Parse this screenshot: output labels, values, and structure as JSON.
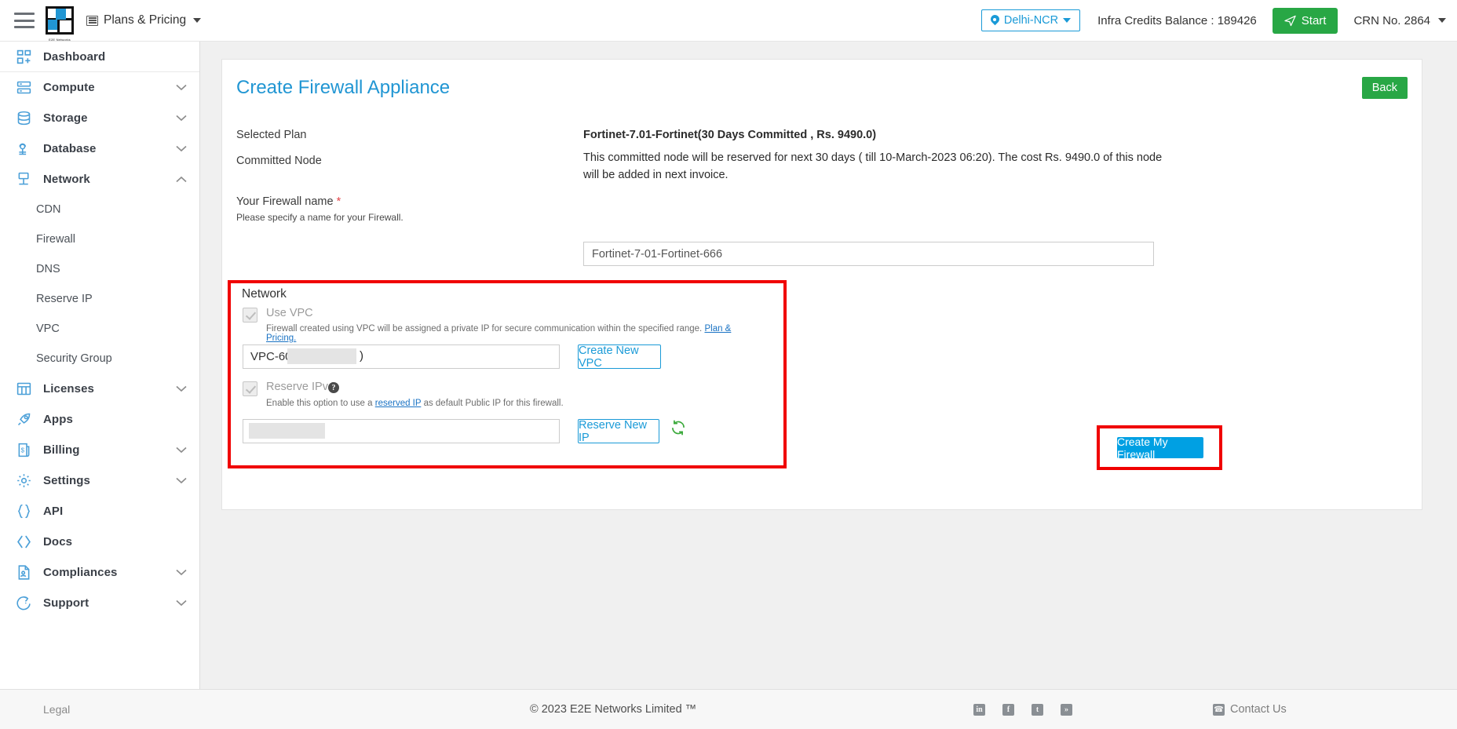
{
  "topbar": {
    "menu_icon": "hamburger-icon",
    "brand_name": "E2E Networks",
    "plans_pricing": "Plans & Pricing",
    "region": "Delhi-NCR",
    "credits": "Infra Credits Balance : 189426",
    "start_button": "Start",
    "crn": "CRN No. 2864"
  },
  "sidebar": {
    "items": [
      {
        "label": "Dashboard",
        "icon": "dashboard-icon",
        "expandable": false
      },
      {
        "label": "Compute",
        "icon": "compute-icon",
        "expandable": true,
        "state": "collapsed"
      },
      {
        "label": "Storage",
        "icon": "storage-icon",
        "expandable": true,
        "state": "collapsed"
      },
      {
        "label": "Database",
        "icon": "database-icon",
        "expandable": true,
        "state": "collapsed"
      },
      {
        "label": "Network",
        "icon": "network-icon",
        "expandable": true,
        "state": "expanded"
      },
      {
        "label": "Licenses",
        "icon": "licenses-icon",
        "expandable": true,
        "state": "collapsed"
      },
      {
        "label": "Apps",
        "icon": "apps-rocket-icon",
        "expandable": false
      },
      {
        "label": "Billing",
        "icon": "billing-icon",
        "expandable": true,
        "state": "collapsed"
      },
      {
        "label": "Settings",
        "icon": "gear-icon",
        "expandable": true,
        "state": "collapsed"
      },
      {
        "label": "API",
        "icon": "api-braces-icon",
        "expandable": false
      },
      {
        "label": "Docs",
        "icon": "docs-angle-brackets-icon",
        "expandable": false
      },
      {
        "label": "Compliances",
        "icon": "compliances-doc-icon",
        "expandable": true,
        "state": "collapsed"
      },
      {
        "label": "Support",
        "icon": "support-icon",
        "expandable": true,
        "state": "collapsed"
      }
    ],
    "network_children": [
      "CDN",
      "Firewall",
      "DNS",
      "Reserve IP",
      "VPC",
      "Security Group"
    ]
  },
  "page": {
    "title": "Create Firewall Appliance",
    "back_button": "Back",
    "selected_plan_label": "Selected Plan",
    "selected_plan_value": "Fortinet-7.01-Fortinet(30 Days Committed , Rs. 9490.0)",
    "committed_node_label": "Committed Node",
    "committed_node_value": "This committed node will be reserved for next 30 days ( till 10-March-2023 06:20). The cost Rs. 9490.0 of this node will be added in next invoice.",
    "firewall_name_label": "Your Firewall name",
    "firewall_name_required": "*",
    "firewall_name_hint": "Please specify a name for your Firewall.",
    "firewall_name_value": "Fortinet-7-01-Fortinet-666",
    "submit_button": "Create My Firewall"
  },
  "network": {
    "section_title": "Network",
    "use_vpc_label": "Use VPC",
    "use_vpc_checked": true,
    "use_vpc_desc_part1": "Firewall created using VPC will be assigned a private IP for secure communication within the specified range.",
    "use_vpc_desc_link": "Plan & Pricing.",
    "vpc_selected": "VPC-602(",
    "vpc_selected_suffix": ")",
    "create_new_vpc_button": "Create New VPC",
    "reserve_ipv4_label": "Reserve IPv4",
    "reserve_ipv4_checked": true,
    "reserve_ipv4_help": "?",
    "reserve_ipv4_desc_part1": "Enable this option to use a",
    "reserve_ipv4_desc_link": "reserved IP",
    "reserve_ipv4_desc_part2": "as default Public IP for this firewall.",
    "reserved_ip_selected": "",
    "reserve_new_ip_button": "Reserve New IP",
    "refresh_icon": "refresh-icon"
  },
  "footer": {
    "legal": "Legal",
    "copyright": "© 2023 E2E Networks Limited ™",
    "social": [
      {
        "name": "linkedin-icon",
        "glyph": "in"
      },
      {
        "name": "facebook-icon",
        "glyph": "f"
      },
      {
        "name": "twitter-icon",
        "glyph": "t"
      },
      {
        "name": "rss-icon",
        "glyph": "»"
      }
    ],
    "contact": "Contact Us"
  },
  "colors": {
    "accent_blue": "#2196d3",
    "link_blue": "#1a9ad7",
    "green": "#28a745",
    "highlight_red": "#f00000",
    "submit_blue": "#00a0e3"
  }
}
